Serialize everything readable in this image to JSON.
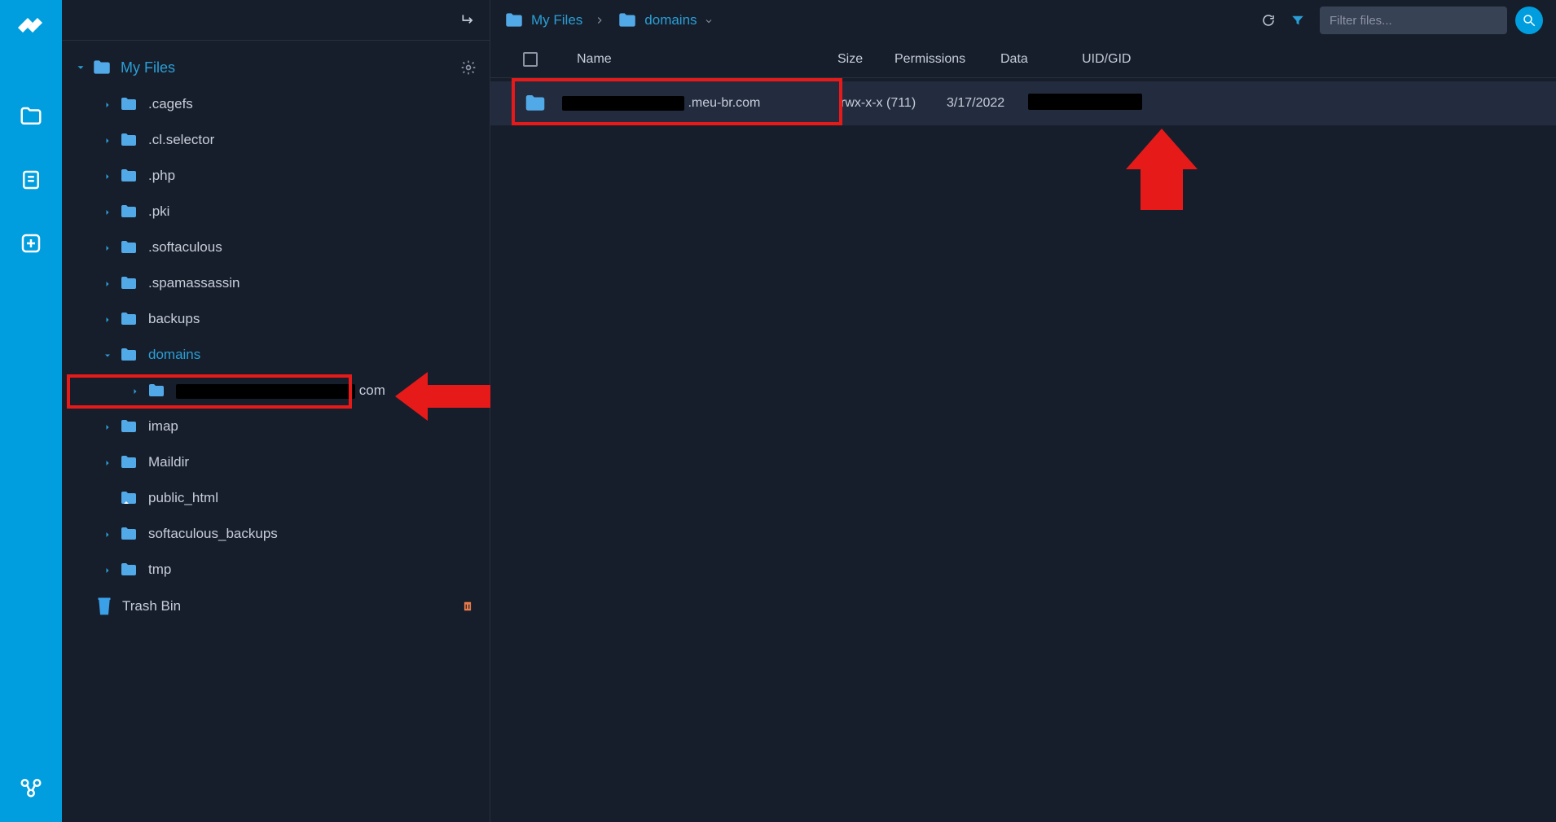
{
  "sidebar": {
    "logo_name": "app-logo"
  },
  "tree": {
    "root_label": "My Files",
    "items": [
      {
        "label": ".cagefs",
        "active": false
      },
      {
        "label": ".cl.selector",
        "active": false
      },
      {
        "label": ".php",
        "active": false
      },
      {
        "label": ".pki",
        "active": false
      },
      {
        "label": ".softaculous",
        "active": false
      },
      {
        "label": ".spamassassin",
        "active": false
      },
      {
        "label": "backups",
        "active": false
      },
      {
        "label": "domains",
        "active": true
      },
      {
        "label": "imap",
        "active": false
      },
      {
        "label": "Maildir",
        "active": false
      },
      {
        "label": "public_html",
        "active": false,
        "no_chevron": true,
        "shortcut": true
      },
      {
        "label": "softaculous_backups",
        "active": false
      },
      {
        "label": "tmp",
        "active": false
      }
    ],
    "domain_child_suffix": "com",
    "trash_label": "Trash Bin"
  },
  "breadcrumb": {
    "first": "My Files",
    "second": "domains"
  },
  "toolbar": {
    "filter_placeholder": "Filter files..."
  },
  "columns": {
    "name": "Name",
    "size": "Size",
    "perm": "Permissions",
    "date": "Data",
    "uid": "UID/GID"
  },
  "row": {
    "name_suffix": ".meu-br.com",
    "permissions": "rwx-x-x (711)",
    "date": "3/17/2022"
  }
}
